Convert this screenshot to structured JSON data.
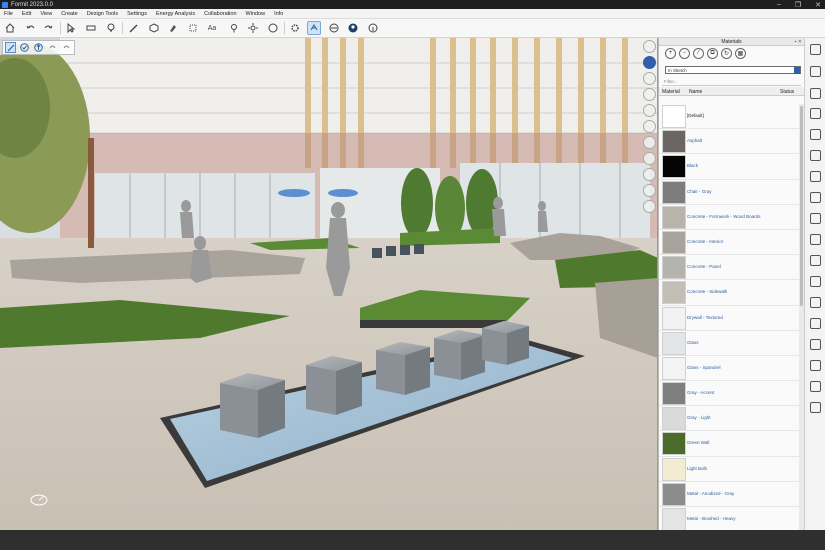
{
  "window": {
    "title": "Formit 2023.0.0",
    "controls": [
      "–",
      "❐",
      "✕"
    ]
  },
  "menu": [
    "File",
    "Edit",
    "View",
    "Create",
    "Design Tools",
    "Settings",
    "Energy Analysis",
    "Collaboration",
    "Window",
    "Info"
  ],
  "toolbar": {
    "buttons": [
      {
        "name": "home-icon",
        "active": false
      },
      {
        "name": "undo-icon",
        "active": false
      },
      {
        "name": "redo-icon",
        "active": false
      },
      {
        "name": "select-icon",
        "active": false
      },
      {
        "name": "measure-icon",
        "active": false
      },
      {
        "name": "bulb-icon",
        "active": false
      },
      {
        "name": "pencil-icon",
        "active": false
      },
      {
        "name": "cube-icon",
        "active": false
      },
      {
        "name": "paint-icon",
        "active": false
      },
      {
        "name": "section-icon",
        "active": false
      },
      {
        "name": "text-icon",
        "active": false
      },
      {
        "name": "pin-icon",
        "active": false
      },
      {
        "name": "sun-icon",
        "active": false
      },
      {
        "name": "render-icon",
        "active": false
      },
      {
        "name": "settings-icon",
        "active": false
      },
      {
        "name": "orbit-icon",
        "active": true
      },
      {
        "name": "share-icon",
        "active": false
      },
      {
        "name": "user-icon",
        "active": false
      },
      {
        "name": "info-icon",
        "active": false
      }
    ],
    "text_tool_label": "Aa"
  },
  "materials_panel": {
    "title": "Materials",
    "library": "In Sketch",
    "filter_placeholder": "Filter...",
    "columns": {
      "material": "Material",
      "name": "Name",
      "status": "Status"
    },
    "colors": {
      "accent": "#2f5fa8",
      "link": "#2e5f9b"
    },
    "items": [
      {
        "name": "[Default]",
        "swatch": "#ffffff"
      },
      {
        "name": "Asphalt",
        "swatch": "#6b6563"
      },
      {
        "name": "Black",
        "swatch": "#050505"
      },
      {
        "name": "Chair - Gray",
        "swatch": "#7d7d7d"
      },
      {
        "name": "Concrete - Formwork - Wood Boards",
        "swatch": "#b8b3ab"
      },
      {
        "name": "Concrete - Interior",
        "swatch": "#a9a39c"
      },
      {
        "name": "Concrete - Panel",
        "swatch": "#b5b3ae"
      },
      {
        "name": "Concrete - Sidewalk",
        "swatch": "#c3beb6"
      },
      {
        "name": "Drywall - Textured",
        "swatch": "#f2f2f2"
      },
      {
        "name": "Glass",
        "swatch": "#e3e6e8"
      },
      {
        "name": "Glass - Spandrel",
        "swatch": "#f3f3f3"
      },
      {
        "name": "Gray - Accent",
        "swatch": "#7e7e7e"
      },
      {
        "name": "Gray - Light",
        "swatch": "#dadada"
      },
      {
        "name": "Green Wall",
        "swatch": "#4b6b2a"
      },
      {
        "name": "Light Bulb",
        "swatch": "#f2ecd3"
      },
      {
        "name": "Metal - Anodized - Gray",
        "swatch": "#8c8c8c"
      },
      {
        "name": "Metal - Brushed - Heavy",
        "swatch": "#e4e4e4"
      }
    ]
  }
}
